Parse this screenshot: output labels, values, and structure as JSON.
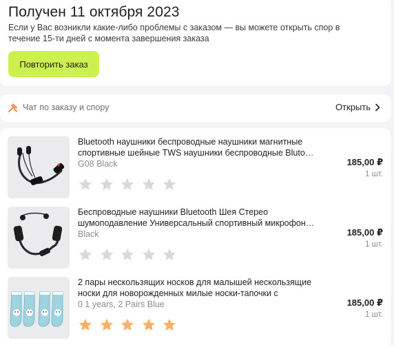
{
  "order": {
    "status_title": "Получен 11 октября 2023",
    "status_text": "Если у Вас возникли какие-либо проблемы с заказом — вы можете открыть спор в течение 15-ти дней с момента завершения заказа",
    "repeat_button": "Повторить заказ"
  },
  "chat": {
    "icon": "chat-dispute-icon",
    "label": "Чат по заказу и спору",
    "open_link": "Открыть"
  },
  "colors": {
    "accent_button": "#ccf04d",
    "star_filled": "#f9b069",
    "star_empty": "#d9d9d9"
  },
  "items": [
    {
      "title_line1": "Bluetooth наушники беспроводные наушники магнитные",
      "title_line2": "спортивные шейные TWS наушники беспроводные Blutooth",
      "variant": "G08 Black",
      "price": "185,00 ₽",
      "quantity": "1 шт.",
      "rating": 0,
      "rating_max": 5,
      "image": "neckband-earphones-image"
    },
    {
      "title_line1": "Беспроводные наушники Bluetooth Шея Стерео",
      "title_line2": "шумоподавление Универсальный спортивный микрофон для",
      "variant": "Black",
      "price": "185,00 ₽",
      "quantity": "1 шт.",
      "rating": 0,
      "rating_max": 5,
      "image": "neckband-headset-image"
    },
    {
      "title_line1": "2 пары нескользящих носков для малышей нескользящие",
      "title_line2": "носки для новорожденных милые носки-тапочки с",
      "variant": "0 1 years, 2 Pairs Blue",
      "price": "185,00 ₽",
      "quantity": "1 шт.",
      "rating": 5,
      "rating_max": 5,
      "image": "baby-socks-image"
    }
  ]
}
